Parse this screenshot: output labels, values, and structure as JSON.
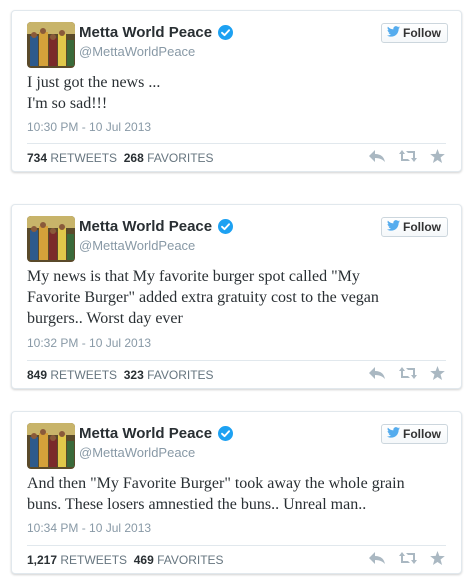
{
  "colors": {
    "text": "#292f33",
    "muted": "#8899a6",
    "border": "#e1e8ed",
    "verified": "#1da1f2",
    "twitter_bird": "#55acee"
  },
  "tweets": [
    {
      "author_name": "Metta World Peace",
      "handle": "@MettaWorldPeace",
      "follow_label": "Follow",
      "text_lines": [
        "I just got the news ...",
        "I'm so sad!!!"
      ],
      "timestamp": "10:30 PM - 10 Jul 2013",
      "retweets": "734",
      "retweets_label": "RETWEETS",
      "favorites": "268",
      "favorites_label": "FAVORITES"
    },
    {
      "author_name": "Metta World Peace",
      "handle": "@MettaWorldPeace",
      "follow_label": "Follow",
      "text_lines": [
        "My news is that My favorite burger spot called \"My",
        "Favorite Burger\" added extra gratuity cost to the vegan",
        "burgers.. Worst day ever"
      ],
      "timestamp": "10:32 PM - 10 Jul 2013",
      "retweets": "849",
      "retweets_label": "RETWEETS",
      "favorites": "323",
      "favorites_label": "FAVORITES"
    },
    {
      "author_name": "Metta World Peace",
      "handle": "@MettaWorldPeace",
      "follow_label": "Follow",
      "text_lines": [
        "And then \"My Favorite Burger\" took away the whole grain",
        "buns. These losers amnestied the buns.. Unreal man.."
      ],
      "timestamp": "10:34 PM - 10 Jul 2013",
      "retweets": "1,217",
      "retweets_label": "RETWEETS",
      "favorites": "469",
      "favorites_label": "FAVORITES"
    }
  ],
  "icons": {
    "verified": "verified-badge-icon",
    "follow": "twitter-bird-icon",
    "reply": "reply-icon",
    "retweet": "retweet-icon",
    "favorite": "star-icon"
  }
}
